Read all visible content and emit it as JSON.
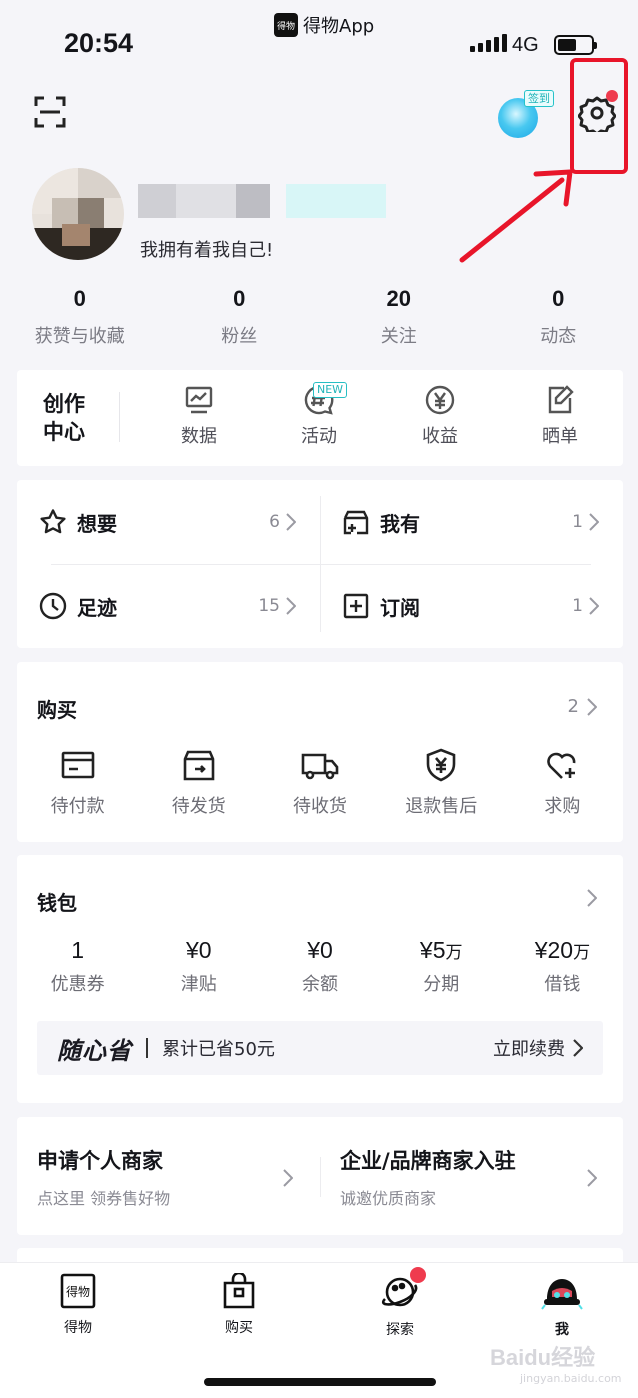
{
  "status_bar": {
    "time": "20:54",
    "app_name": "得物App",
    "app_icon_text": "得物",
    "network": "4G"
  },
  "header": {
    "sign_in_tag": "签到"
  },
  "profile": {
    "bio": "我拥有着我自己!"
  },
  "stats": [
    {
      "value": "0",
      "label": "获赞与收藏"
    },
    {
      "value": "0",
      "label": "粉丝"
    },
    {
      "value": "20",
      "label": "关注"
    },
    {
      "value": "0",
      "label": "动态"
    }
  ],
  "creator_center": {
    "title": "创作中心",
    "items": [
      {
        "label": "数据",
        "icon": "chart-icon"
      },
      {
        "label": "活动",
        "icon": "hashtag-bubble-icon",
        "badge": "NEW"
      },
      {
        "label": "收益",
        "icon": "yen-coin-icon"
      },
      {
        "label": "晒单",
        "icon": "edit-note-icon"
      }
    ]
  },
  "collections": [
    {
      "label": "想要",
      "count": "6",
      "icon": "star-icon"
    },
    {
      "label": "我有",
      "count": "1",
      "icon": "box-plus-icon"
    },
    {
      "label": "足迹",
      "count": "15",
      "icon": "clock-icon"
    },
    {
      "label": "订阅",
      "count": "1",
      "icon": "plus-square-icon"
    }
  ],
  "purchase": {
    "title": "购买",
    "count": "2",
    "items": [
      {
        "label": "待付款",
        "icon": "card-icon"
      },
      {
        "label": "待发货",
        "icon": "package-icon"
      },
      {
        "label": "待收货",
        "icon": "truck-icon"
      },
      {
        "label": "退款售后",
        "icon": "shield-yen-icon"
      },
      {
        "label": "求购",
        "icon": "heart-plus-icon"
      }
    ]
  },
  "wallet": {
    "title": "钱包",
    "items": [
      {
        "value": "1",
        "unit": "",
        "label": "优惠券"
      },
      {
        "value": "¥0",
        "unit": "",
        "label": "津贴"
      },
      {
        "value": "¥0",
        "unit": "",
        "label": "余额"
      },
      {
        "value": "¥5",
        "unit": "万",
        "label": "分期"
      },
      {
        "value": "¥20",
        "unit": "万",
        "label": "借钱"
      }
    ],
    "vip_brand": "随心省",
    "vip_saved": "累计已省50元",
    "vip_action": "立即续费"
  },
  "merchant": {
    "personal_title": "申请个人商家",
    "personal_sub": "点这里 领券售好物",
    "brand_title": "企业/品牌商家入驻",
    "brand_sub": "诚邀优质商家"
  },
  "tabbar": [
    {
      "label": "得物",
      "icon": "dewu-logo-icon"
    },
    {
      "label": "购买",
      "icon": "shopping-bag-icon"
    },
    {
      "label": "探索",
      "icon": "planet-icon"
    },
    {
      "label": "我",
      "icon": "mascot-icon"
    }
  ],
  "colors": {
    "accent_red": "#ef3b4e",
    "teal": "#22b4b9",
    "highlight_red": "#e8152a"
  },
  "watermark": {
    "main": "Baidu经验",
    "sub": "jingyan.baidu.com"
  }
}
